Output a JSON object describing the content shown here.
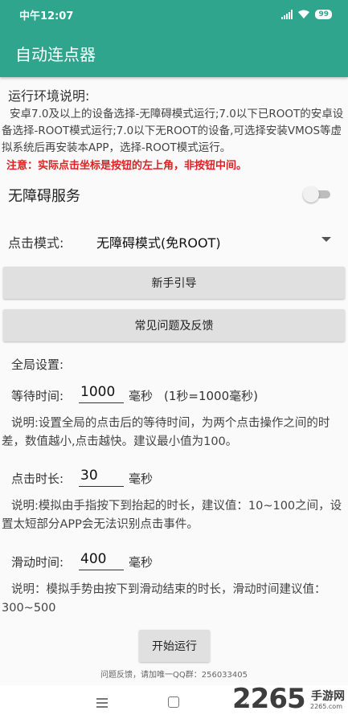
{
  "status_bar": {
    "time": "中午12:07",
    "battery": "99"
  },
  "app": {
    "title": "自动连点器"
  },
  "environment": {
    "title": "运行环境说明:",
    "description": "安卓7.0及以上的设备选择-无障碍模式运行;7.0以下已ROOT的安卓设备选择-ROOT模式运行;7.0以下无ROOT的设备,可选择安装VMOS等虚拟系统后再安装本APP，选择-ROOT模式运行。",
    "note": "注意：实际点击坐标是按钮的左上角，非按钮中间。"
  },
  "accessibility_service": {
    "label": "无障碍服务",
    "enabled": false
  },
  "click_mode": {
    "label": "点击模式:",
    "selected": "无障碍模式(免ROOT)"
  },
  "buttons": {
    "guide": "新手引导",
    "faq": "常见问题及反馈",
    "start": "开始运行"
  },
  "global_settings": {
    "title": "全局设置:",
    "wait_time": {
      "label": "等待时间:",
      "value": "1000",
      "unit": "毫秒",
      "hint": "(1秒=1000毫秒)",
      "description": "说明:设置全局的点击后的等待时间，为两个点击操作之间的时差，数值越小,点击越快。建议最小值为100。"
    },
    "click_duration": {
      "label": "点击时长:",
      "value": "30",
      "unit": "毫秒",
      "description": "说明:模拟由手指按下到抬起的时长，建议值：10~100之间，设置太短部分APP会无法识别点击事件。"
    },
    "swipe_duration": {
      "label": "滑动时间:",
      "value": "400",
      "unit": "毫秒",
      "description": "说明：模拟手势由按下到滑动结束的时长，滑动时间建议值：300~500"
    }
  },
  "feedback": "问题反馈，请加唯一QQ群：256033405",
  "watermark": {
    "number": "2265",
    "suffix": "手游网",
    "domain": "2265.com"
  },
  "colors": {
    "primary": "#2fa58e",
    "warning": "#e02020"
  }
}
